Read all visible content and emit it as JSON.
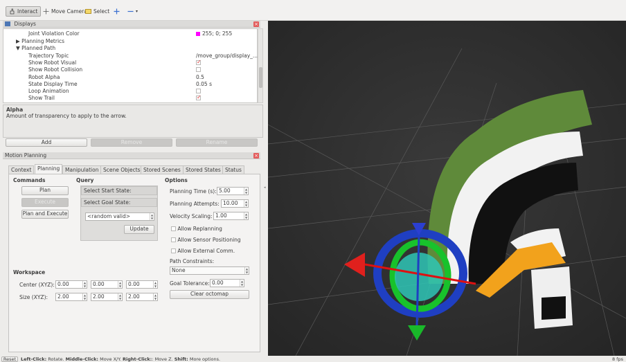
{
  "toolbar": {
    "interact": "Interact",
    "move_camera": "Move Camera",
    "select": "Select"
  },
  "displays": {
    "title": "Displays",
    "rows": [
      {
        "key": "Joint Violation Color",
        "value": "255; 0; 255"
      },
      {
        "key": "Planning Metrics"
      },
      {
        "key": "Planned Path"
      },
      {
        "key": "Trajectory Topic",
        "value": "/move_group/display_..."
      },
      {
        "key": "Show Robot Visual",
        "checked": true
      },
      {
        "key": "Show Robot Collision",
        "checked": false
      },
      {
        "key": "Robot Alpha",
        "value": "0.5"
      },
      {
        "key": "State Display Time",
        "value": "0.05 s"
      },
      {
        "key": "Loop Animation",
        "checked": false
      },
      {
        "key": "Show Trail",
        "checked": true
      }
    ],
    "desc_title": "Alpha",
    "desc_text": "Amount of transparency to apply to the arrow.",
    "add": "Add",
    "remove": "Remove",
    "rename": "Rename"
  },
  "motion": {
    "title": "Motion Planning",
    "tabs": [
      "Context",
      "Planning",
      "Manipulation",
      "Scene Objects",
      "Stored Scenes",
      "Stored States",
      "Status"
    ],
    "commands": "Commands",
    "plan": "Plan",
    "execute": "Execute",
    "plan_execute": "Plan and Execute",
    "query": "Query",
    "start_state": "Select Start State:",
    "goal_state": "Select Goal State:",
    "random_valid": "<random valid>",
    "update": "Update",
    "options": "Options",
    "planning_time_label": "Planning Time (s):",
    "planning_time": "5.00",
    "attempts_label": "Planning Attempts:",
    "attempts": "10.00",
    "velocity_label": "Velocity Scaling:",
    "velocity": "1.00",
    "allow_replanning": "Allow Replanning",
    "allow_sensor": "Allow Sensor Positioning",
    "allow_external": "Allow External Comm.",
    "path_constraints_label": "Path Constraints:",
    "path_constraints": "None",
    "goal_tolerance_label": "Goal Tolerance:",
    "goal_tolerance": "0.00",
    "clear_octomap": "Clear octomap",
    "workspace": "Workspace",
    "center_label": "Center (XYZ):",
    "center": [
      "0.00",
      "0.00",
      "0.00"
    ],
    "size_label": "Size (XYZ):",
    "size": [
      "2.00",
      "2.00",
      "2.00"
    ]
  },
  "status": {
    "reset": "Reset",
    "hint_lc": "Left-Click:",
    "hint_lc_v": " Rotate. ",
    "hint_mc": "Middle-Click:",
    "hint_mc_v": " Move X/Y. ",
    "hint_rc": "Right-Click:",
    "hint_rc_v": ": Move Z. ",
    "hint_sh": "Shift:",
    "hint_sh_v": " More options.",
    "fps": "8 fps"
  },
  "colors": {
    "accent_red": "#e35c5c",
    "swatch": "#ff00ff",
    "trail_green": "#5f8a3a",
    "robot_orange": "#f2a21c"
  }
}
